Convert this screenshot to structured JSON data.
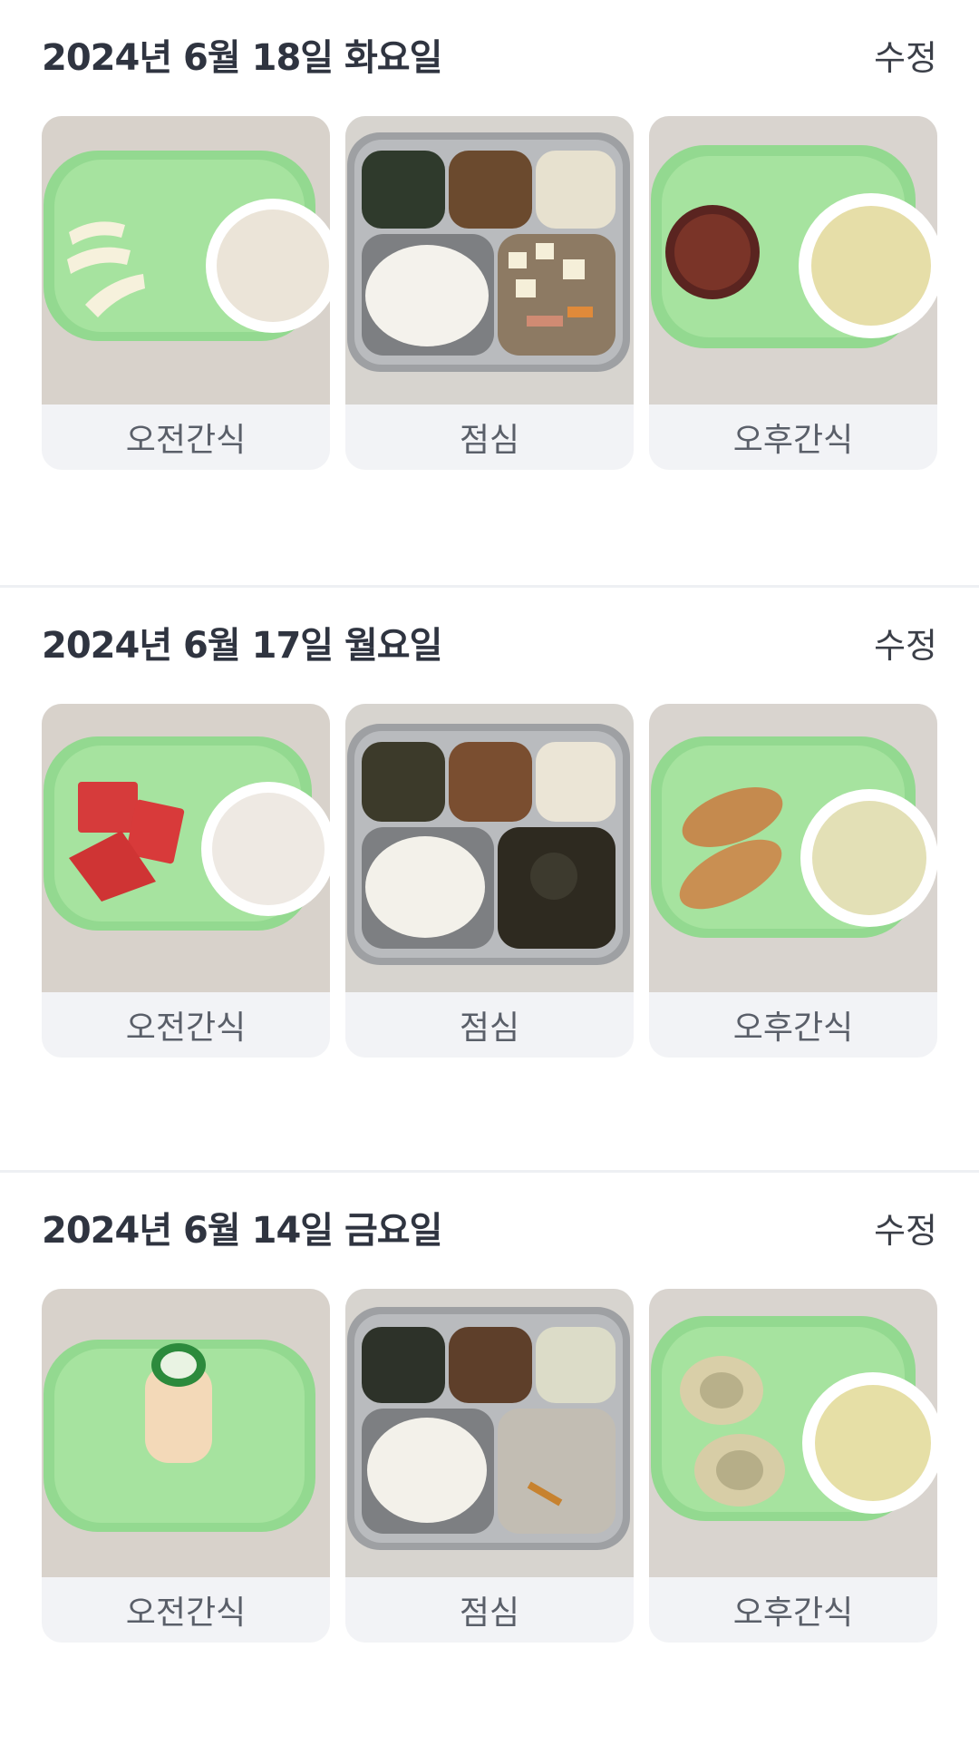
{
  "days": [
    {
      "date_label": "2024년 6월 18일 화요일",
      "edit_label": "수정",
      "meals": [
        {
          "label": "오전간식",
          "photo": "tray-melon-milk-photo"
        },
        {
          "label": "점심",
          "photo": "lunch-tray-tofu-stew-photo"
        },
        {
          "label": "오후간식",
          "photo": "tray-jelly-juice-photo"
        }
      ]
    },
    {
      "date_label": "2024년 6월 17일 월요일",
      "edit_label": "수정",
      "meals": [
        {
          "label": "오전간식",
          "photo": "tray-watermelon-milk-photo"
        },
        {
          "label": "점심",
          "photo": "lunch-tray-seaweed-photo"
        },
        {
          "label": "오후간식",
          "photo": "tray-fried-pastry-juice-photo"
        }
      ]
    },
    {
      "date_label": "2024년 6월 14일 금요일",
      "edit_label": "수정",
      "meals": [
        {
          "label": "오전간식",
          "photo": "tray-yogurt-drink-photo"
        },
        {
          "label": "점심",
          "photo": "lunch-tray-porridge-photo"
        },
        {
          "label": "오후간식",
          "photo": "tray-dumplings-juice-photo"
        }
      ]
    }
  ]
}
